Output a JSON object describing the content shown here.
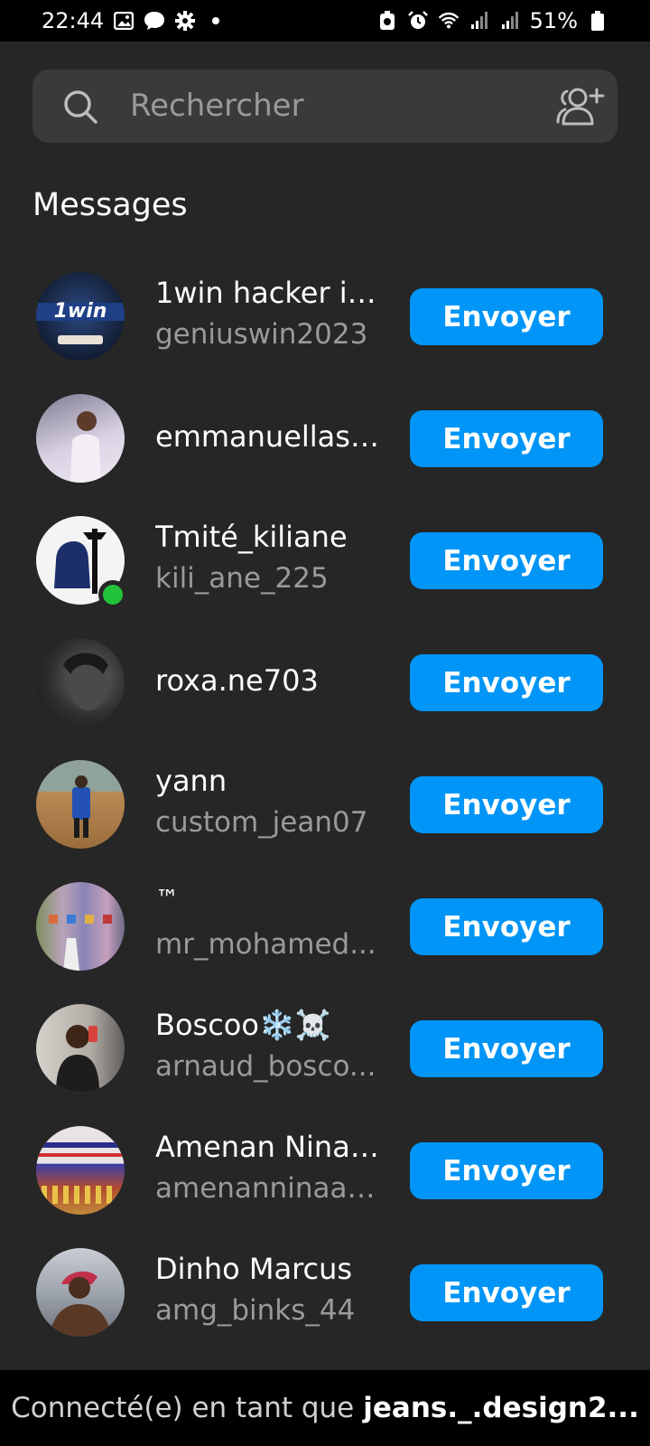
{
  "status_bar": {
    "time": "22:44",
    "battery": "51%"
  },
  "search": {
    "placeholder": "Rechercher"
  },
  "section_title": "Messages",
  "contacts": [
    {
      "name": "1win hacker iv...",
      "handle": "geniuswin2023",
      "button": "Envoyer",
      "avatar_color": "#1b2a4a"
    },
    {
      "name": "emmanuellast...",
      "handle": "",
      "button": "Envoyer",
      "avatar_color": "#c9c3d6"
    },
    {
      "name": "Tmité_kiliane",
      "handle": "kili_ane_225",
      "button": "Envoyer",
      "avatar_color": "#f2f2f2",
      "online": true
    },
    {
      "name": "roxa.ne703",
      "handle": "",
      "button": "Envoyer",
      "avatar_color": "#3b3b3b"
    },
    {
      "name": "yann",
      "handle": "custom_jean07",
      "button": "Envoyer",
      "avatar_color": "#a07a4a"
    },
    {
      "name": "™",
      "handle": "mr_mohamed...",
      "button": "Envoyer",
      "avatar_color": "#8a7a8c"
    },
    {
      "name": "Boscoo❄️☠️",
      "handle": "arnaud_bosco...",
      "button": "Envoyer",
      "avatar_color": "#b9b3ad"
    },
    {
      "name": "Amenan Nina ...",
      "handle": "amenanninaan...",
      "button": "Envoyer",
      "avatar_color": "#b24b2f"
    },
    {
      "name": "Dinho Marcus",
      "handle": "amg_binks_44",
      "button": "Envoyer",
      "avatar_color": "#6c6f78"
    }
  ],
  "footer": {
    "prefix": "Connecté(e) en tant que",
    "username": "jeans._.design2..."
  },
  "colors": {
    "background": "#262626",
    "accent": "#0095f6",
    "online": "#22c33a"
  }
}
